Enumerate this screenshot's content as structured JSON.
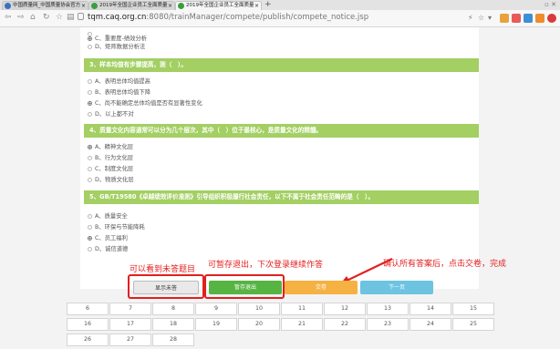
{
  "browser": {
    "tabs": [
      {
        "title": "中国质量网_中国质量协会官方",
        "active": false,
        "favicon_color": "#3a6fc4"
      },
      {
        "title": "2019年全国企业员工全面质量",
        "active": false,
        "favicon_color": "#3a9e3f"
      },
      {
        "title": "2019年全国企业员工全面质量",
        "active": true,
        "favicon_color": "#3a9e3f"
      }
    ],
    "url_host": "tqm.caq.org.cn",
    "url_rest": ":8080/trainManager/compete/publish/compete_notice.jsp"
  },
  "exam": {
    "top_options": [
      {
        "label": "",
        "checked": false
      },
      {
        "label": "C、重要度-绩效分析",
        "checked": true
      },
      {
        "label": "D、矩阵数据分析法",
        "checked": false
      }
    ],
    "questions": [
      {
        "text": "3、样本均值有步骤提高，则（　）。",
        "options": [
          {
            "label": "A、表明总体均值提高",
            "checked": false
          },
          {
            "label": "B、表明总体均值下降",
            "checked": false
          },
          {
            "label": "C、尚不能确定总体均值是否有显著性变化",
            "checked": true
          },
          {
            "label": "D、以上都不对",
            "checked": false
          }
        ]
      },
      {
        "text": "4、质量文化内容通常可以分为几个层次，其中（　）位于最核心，是质量文化的精髓。",
        "options": [
          {
            "label": "A、精神文化层",
            "checked": true
          },
          {
            "label": "B、行为文化层",
            "checked": false
          },
          {
            "label": "C、制度文化层",
            "checked": false
          },
          {
            "label": "D、物质文化层",
            "checked": false
          }
        ]
      },
      {
        "text": "5、GB/T19580《卓越绩效评价准则》引导组织积极履行社会责任，以下不属于社会责任范畴的是（　）。",
        "options": [
          {
            "label": "A、质量安全",
            "checked": false
          },
          {
            "label": "B、环保与节能降耗",
            "checked": false
          },
          {
            "label": "C、员工福利",
            "checked": true
          },
          {
            "label": "D、诚信道德",
            "checked": false
          }
        ]
      }
    ],
    "buttons": {
      "show_unanswered": "显示未答",
      "save_exit": "暂存退出",
      "submit": "交卷",
      "next": "下一页"
    },
    "annotations": {
      "unanswered": "可以看到未答题目",
      "save_exit": "可暂存退出，下次登录继续作答",
      "submit": "确认所有答案后，点击交卷，完成"
    },
    "page_numbers": [
      "6",
      "7",
      "8",
      "9",
      "10",
      "11",
      "12",
      "13",
      "14",
      "15",
      "16",
      "17",
      "18",
      "19",
      "20",
      "21",
      "22",
      "23",
      "24",
      "25",
      "26",
      "27",
      "28"
    ]
  },
  "colors": {
    "question_bar": "#a3cf63",
    "save_button": "#56b443",
    "submit_button": "#f6b143",
    "next_button": "#6cc4e0",
    "annotation": "#e21f1f"
  }
}
